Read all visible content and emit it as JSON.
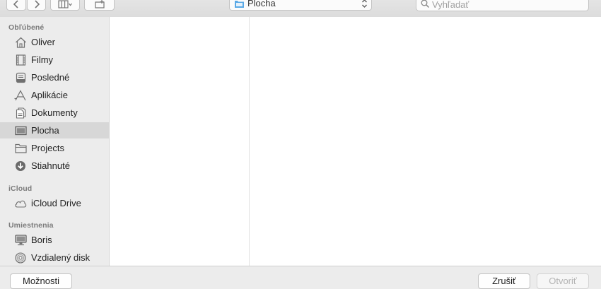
{
  "toolbar": {
    "back_icon": "chevron-left-icon",
    "forward_icon": "chevron-right-icon",
    "view_icon": "column-view-icon",
    "new_folder_icon": "new-folder-icon",
    "location": "Plocha",
    "search_placeholder": "Vyhľadať"
  },
  "sidebar": {
    "sections": [
      {
        "header": "Obľúbené"
      },
      {
        "header": "iCloud"
      },
      {
        "header": "Umiestnenia"
      }
    ],
    "items": [
      {
        "label": "Oliver",
        "icon": "home-icon"
      },
      {
        "label": "Filmy",
        "icon": "film-icon"
      },
      {
        "label": "Posledné",
        "icon": "recents-icon"
      },
      {
        "label": "Aplikácie",
        "icon": "applications-icon"
      },
      {
        "label": "Dokumenty",
        "icon": "documents-icon"
      },
      {
        "label": "Plocha",
        "icon": "desktop-icon",
        "selected": true
      },
      {
        "label": "Projects",
        "icon": "folder-icon"
      },
      {
        "label": "Stiahnuté",
        "icon": "download-icon"
      },
      {
        "label": "iCloud Drive",
        "icon": "cloud-icon"
      },
      {
        "label": "Boris",
        "icon": "computer-icon"
      },
      {
        "label": "Vzdialený disk",
        "icon": "disc-icon"
      }
    ]
  },
  "footer": {
    "options_label": "Možnosti",
    "cancel_label": "Zrušiť",
    "open_label": "Otvoriť"
  },
  "colors": {
    "sidebar_bg": "#ececec",
    "selected_bg": "#d7d7d7",
    "folder_blue": "#5aa9e6"
  }
}
